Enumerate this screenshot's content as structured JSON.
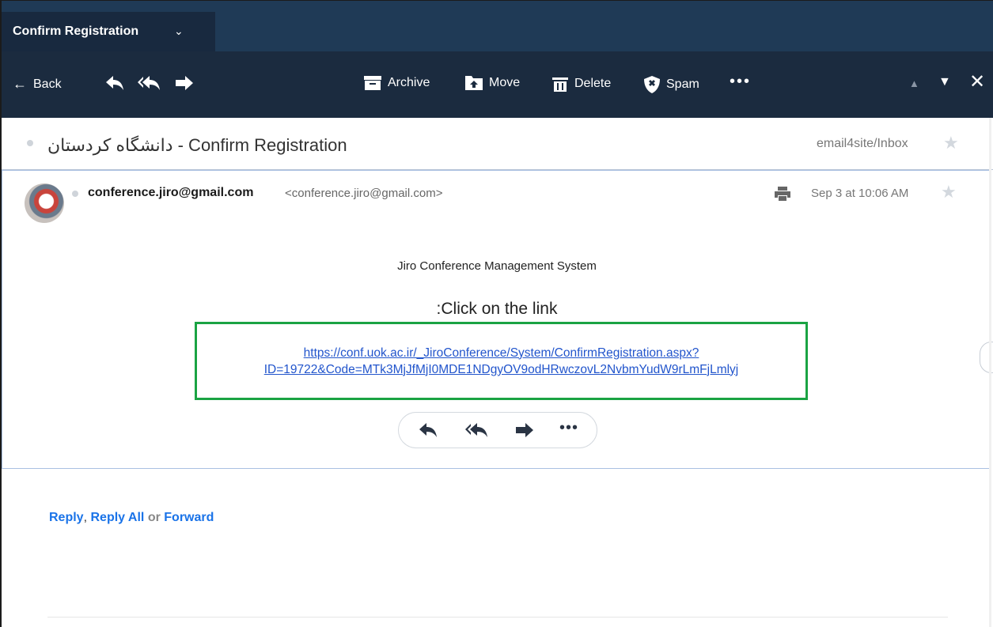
{
  "tab": {
    "title": "Confirm Registration",
    "caret": "⌄"
  },
  "toolbar": {
    "back_label": "Back",
    "archive_label": "Archive",
    "move_label": "Move",
    "delete_label": "Delete",
    "spam_label": "Spam",
    "more_label": "•••",
    "prev_label": "▲",
    "next_label": "▼",
    "close_label": "✕"
  },
  "subject": {
    "text": "دانشگاه کردستان - Confirm Registration",
    "folder": "email4site/Inbox",
    "star": "★"
  },
  "message": {
    "sender_name": "conference.jiro@gmail.com",
    "sender_address": "<conference.jiro@gmail.com>",
    "date": "Sep 3 at 10:06 AM",
    "star": "★",
    "body_title": "Jiro Conference Management System",
    "click_line": ":Click on the link",
    "link_line1": "https://conf.uok.ac.ir/_JiroConference/System/ConfirmRegistration.aspx?",
    "link_line2": "ID=19722&Code=MTk3MjJfMjI0MDE1NDgyOV9odHRwczovL2NvbmYudW9rLmFjLmlyj",
    "more_label": "•••"
  },
  "quick_reply": {
    "reply": "Reply",
    "comma": ",",
    "reply_all": "Reply All",
    "or": "or",
    "forward": "Forward"
  },
  "colors": {
    "tabbar": "#1f3a56",
    "toolbar": "#1b2b3f",
    "link": "#2255cc",
    "highlight_box": "#1aa343",
    "quick_link": "#1a73e8"
  }
}
